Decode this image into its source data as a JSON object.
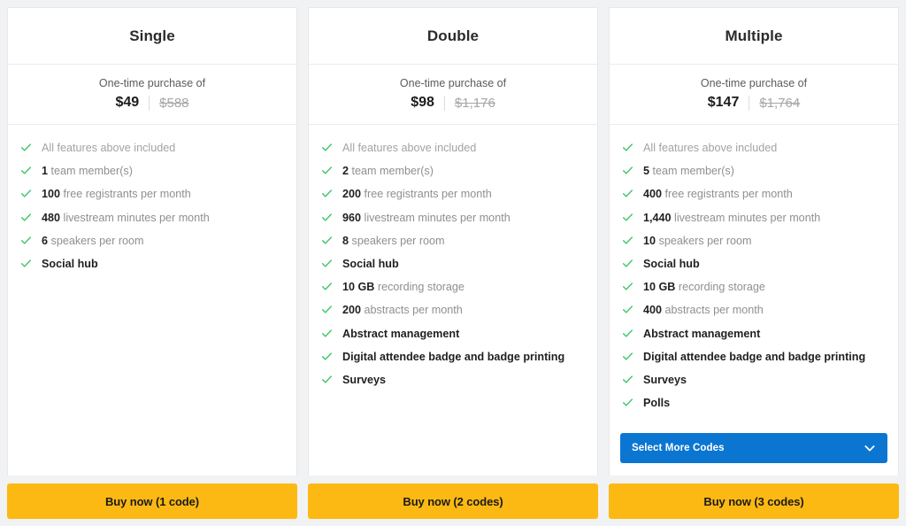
{
  "plans": [
    {
      "title": "Single",
      "price_caption": "One-time purchase of",
      "price_current": "$49",
      "price_old": "$588",
      "features": [
        {
          "style": "muted",
          "prefix": "",
          "text": "All features above included"
        },
        {
          "style": "prefix",
          "prefix": "1",
          "text": "team member(s)"
        },
        {
          "style": "prefix",
          "prefix": "100",
          "text": "free registrants per month"
        },
        {
          "style": "prefix",
          "prefix": "480",
          "text": "livestream minutes per month"
        },
        {
          "style": "prefix",
          "prefix": "6",
          "text": "speakers per room"
        },
        {
          "style": "bold",
          "prefix": "",
          "text": "Social hub"
        }
      ],
      "select_more": null,
      "buy_label": "Buy now (1 code)"
    },
    {
      "title": "Double",
      "price_caption": "One-time purchase of",
      "price_current": "$98",
      "price_old": "$1,176",
      "features": [
        {
          "style": "muted",
          "prefix": "",
          "text": "All features above included"
        },
        {
          "style": "prefix",
          "prefix": "2",
          "text": "team member(s)"
        },
        {
          "style": "prefix",
          "prefix": "200",
          "text": "free registrants per month"
        },
        {
          "style": "prefix",
          "prefix": "960",
          "text": "livestream minutes per month"
        },
        {
          "style": "prefix",
          "prefix": "8",
          "text": "speakers per room"
        },
        {
          "style": "bold",
          "prefix": "",
          "text": "Social hub"
        },
        {
          "style": "prefix",
          "prefix": "10 GB",
          "text": "recording storage"
        },
        {
          "style": "prefix",
          "prefix": "200",
          "text": "abstracts per month"
        },
        {
          "style": "bold",
          "prefix": "",
          "text": "Abstract management"
        },
        {
          "style": "bold",
          "prefix": "",
          "text": "Digital attendee badge and badge printing"
        },
        {
          "style": "bold",
          "prefix": "",
          "text": "Surveys"
        }
      ],
      "select_more": null,
      "buy_label": "Buy now (2 codes)"
    },
    {
      "title": "Multiple",
      "price_caption": "One-time purchase of",
      "price_current": "$147",
      "price_old": "$1,764",
      "features": [
        {
          "style": "muted",
          "prefix": "",
          "text": "All features above included"
        },
        {
          "style": "prefix",
          "prefix": "5",
          "text": "team member(s)"
        },
        {
          "style": "prefix",
          "prefix": "400",
          "text": "free registrants per month"
        },
        {
          "style": "prefix",
          "prefix": "1,440",
          "text": "livestream minutes per month"
        },
        {
          "style": "prefix",
          "prefix": "10",
          "text": "speakers per room"
        },
        {
          "style": "bold",
          "prefix": "",
          "text": "Social hub"
        },
        {
          "style": "prefix",
          "prefix": "10 GB",
          "text": "recording storage"
        },
        {
          "style": "prefix",
          "prefix": "400",
          "text": "abstracts per month"
        },
        {
          "style": "bold",
          "prefix": "",
          "text": "Abstract management"
        },
        {
          "style": "bold",
          "prefix": "",
          "text": "Digital attendee badge and badge printing"
        },
        {
          "style": "bold",
          "prefix": "",
          "text": "Surveys"
        },
        {
          "style": "bold",
          "prefix": "",
          "text": "Polls"
        }
      ],
      "select_more": "Select More Codes",
      "buy_label": "Buy now (3 codes)"
    }
  ],
  "icons": {
    "check": "check-icon",
    "chevron_down": "chevron-down-icon"
  },
  "colors": {
    "accent_amber": "#fdb913",
    "accent_blue": "#0b76d1",
    "check_green": "#3fc56b",
    "page_background": "#f1f2f3"
  }
}
